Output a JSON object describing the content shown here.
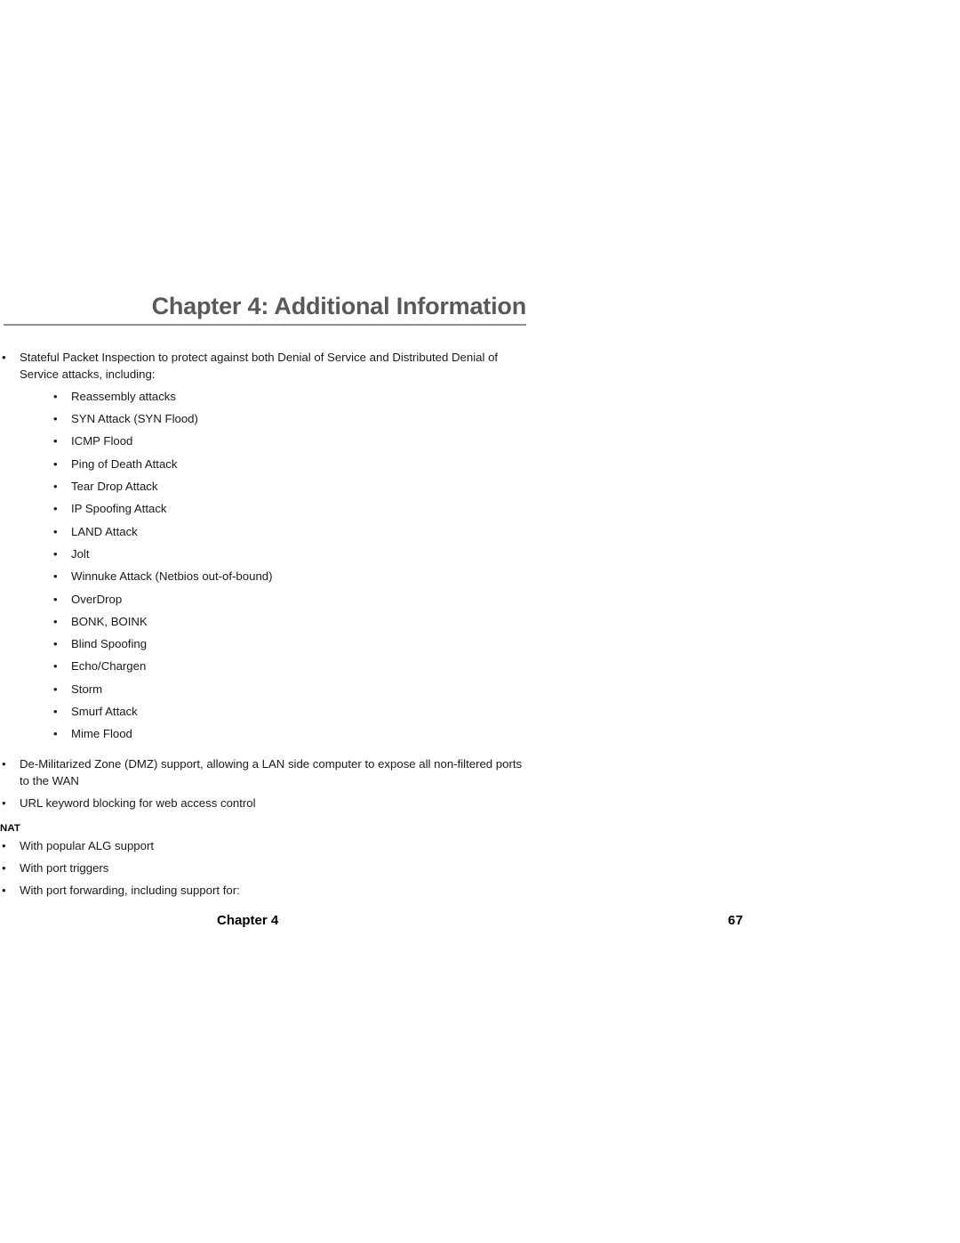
{
  "header": {
    "title": "Chapter 4: Additional Information",
    "rule_color": "#8d8f91",
    "title_color": "#58595b"
  },
  "body": {
    "intro_bullet": "Stateful Packet Inspection to protect against both Denial of Service and Distributed Denial of Service attacks, including:",
    "attack_list": [
      "Reassembly attacks",
      "SYN Attack (SYN Flood)",
      "ICMP Flood",
      "Ping of Death Attack",
      "Tear Drop Attack",
      "IP Spoofing Attack",
      "LAND Attack",
      "Jolt",
      "Winnuke Attack (Netbios out-of-bound)",
      "OverDrop",
      "BONK, BOINK",
      "Blind Spoofing",
      "Echo/Chargen",
      "Storm",
      "Smurf Attack",
      "Mime Flood"
    ],
    "dmz_bullet": "De-Militarized Zone (DMZ) support, allowing a LAN side computer to expose all non-filtered ports to the WAN",
    "url_bullet": "URL keyword blocking for web access control"
  },
  "nat": {
    "heading": "NAT",
    "items": [
      "With popular ALG support",
      "With port triggers",
      "With port forwarding, including support for:"
    ]
  },
  "footer": {
    "chapter": "Chapter 4",
    "page": "67"
  },
  "glyphs": {
    "bullet": "•"
  }
}
